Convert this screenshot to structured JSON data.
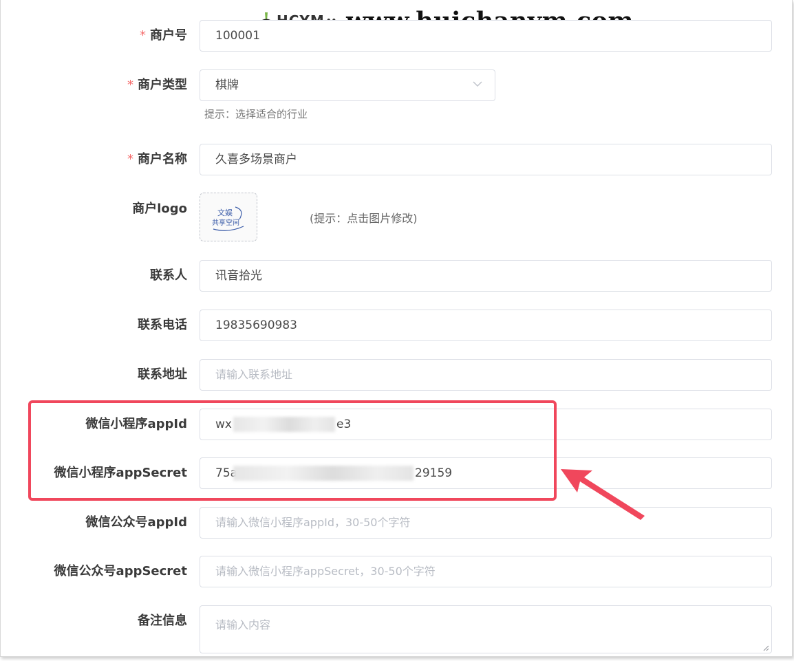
{
  "watermark": {
    "brand": "HCYM",
    "url": "www.huichanym.com"
  },
  "form": {
    "merchant_no": {
      "label": "商户号",
      "required": true,
      "value": "100001"
    },
    "merchant_type": {
      "label": "商户类型",
      "required": true,
      "value": "棋牌",
      "hint": "提示：选择适合的行业"
    },
    "merchant_name": {
      "label": "商户名称",
      "required": true,
      "value": "久喜多场景商户"
    },
    "merchant_logo": {
      "label": "商户logo",
      "hint": "(提示：点击图片修改)",
      "image_text_1": "文娱",
      "image_text_2": "共享空间"
    },
    "contact_person": {
      "label": "联系人",
      "value": "讯音拾光"
    },
    "contact_phone": {
      "label": "联系电话",
      "value": "19835690983"
    },
    "contact_address": {
      "label": "联系地址",
      "placeholder": "请输入联系地址"
    },
    "mini_appid": {
      "label": "微信小程序appId",
      "value_start": "wx",
      "value_end": "e3"
    },
    "mini_secret": {
      "label": "微信小程序appSecret",
      "value_start": "75a",
      "value_end": "29159"
    },
    "mp_appid": {
      "label": "微信公众号appId",
      "placeholder": "请输入微信小程序appId，30-50个字符"
    },
    "mp_secret": {
      "label": "微信公众号appSecret",
      "placeholder": "请输入微信小程序appSecret，30-50个字符"
    },
    "remark": {
      "label": "备注信息",
      "placeholder": "请输入内容"
    }
  },
  "colors": {
    "required": "#f56c6c",
    "highlight": "#f0475c",
    "border": "#dcdfe6",
    "placeholder": "#b8bcc4"
  },
  "icons": {
    "select": "chevron-down-icon",
    "annotation": "arrow-icon"
  }
}
